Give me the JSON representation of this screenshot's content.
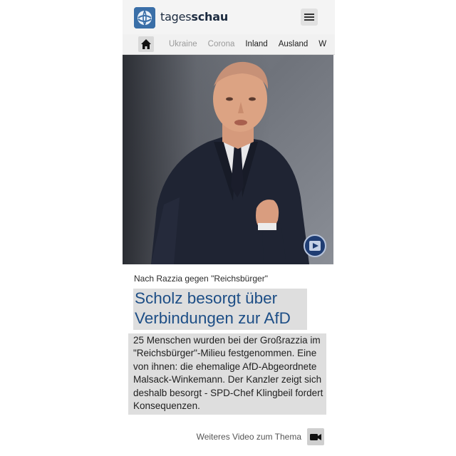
{
  "header": {
    "brand_light": "tages",
    "brand_bold": "schau"
  },
  "nav": {
    "items": [
      {
        "label": "Ukraine"
      },
      {
        "label": "Corona"
      },
      {
        "label": "Inland"
      },
      {
        "label": "Ausland"
      },
      {
        "label": "W"
      }
    ]
  },
  "article": {
    "topline": "Nach Razzia gegen \"Reichsbürger\"",
    "headline": "Scholz besorgt über Verbindungen zur AfD",
    "teaser": "25 Menschen wurden bei der Großrazzia im \"Reichsbürger\"-Milieu festgenommen. Eine von ihnen: die ehemalige AfD-Abgeordnete Malsack-Winkemann. Der Kanzler zeigt sich deshalb besorgt - SPD-Chef Klingbeil fordert Konsequenzen.",
    "more_video_label": "Weiteres Video zum Thema"
  },
  "colors": {
    "headline": "#1d4e86",
    "play_button": "#1f3d73",
    "logo": "#3a6fa8"
  },
  "icons": {
    "logo": "tagesschau-globe-icon",
    "menu": "hamburger-menu-icon",
    "home": "home-icon",
    "play": "play-icon",
    "video": "video-camera-icon"
  }
}
